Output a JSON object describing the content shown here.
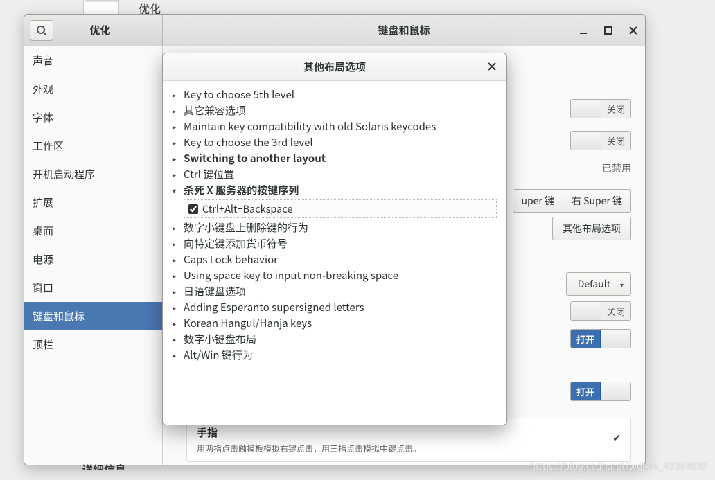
{
  "behind": {
    "title": "优化"
  },
  "window": {
    "title_left": "优化",
    "title_center": "键盘和鼠标",
    "controls": {
      "min": "—",
      "max": "□",
      "close": "×"
    }
  },
  "sidebar": {
    "items": [
      {
        "label": "声音"
      },
      {
        "label": "外观"
      },
      {
        "label": "字体"
      },
      {
        "label": "工作区"
      },
      {
        "label": "开机启动程序"
      },
      {
        "label": "扩展"
      },
      {
        "label": "桌面"
      },
      {
        "label": "电源"
      },
      {
        "label": "窗口"
      },
      {
        "label": "键盘和鼠标",
        "selected": true
      },
      {
        "label": "顶栏"
      }
    ]
  },
  "content": {
    "switch_off_label": "关闭",
    "switch_on_label": "打开",
    "disabled_text": "已禁用",
    "seg_left": "uper 键",
    "seg_right": "右  Super 键",
    "other_layout_btn": "其他布局选项",
    "combo_default": "Default",
    "fingers": {
      "title": "手指",
      "desc": "用两指点击触摸板模拟右键点击，用三指点击模拟中键点击。"
    }
  },
  "dialog": {
    "title": "其他布局选项",
    "items": [
      {
        "label": "Key to choose 5th level"
      },
      {
        "label": "其它兼容选项"
      },
      {
        "label": "Maintain key compatibility with old Solaris keycodes"
      },
      {
        "label": "Key to choose the 3rd level"
      },
      {
        "label": "Switching to another layout",
        "bold": true
      },
      {
        "label": "Ctrl 键位置"
      },
      {
        "label": "杀死  X 服务器的按键序列",
        "bold": true,
        "expanded": true,
        "child": "Ctrl+Alt+Backspace",
        "checked": true
      },
      {
        "label": "数字小键盘上删除键的行为"
      },
      {
        "label": "向特定键添加货币符号"
      },
      {
        "label": "Caps Lock behavior"
      },
      {
        "label": "Using space key to input non-breaking space"
      },
      {
        "label": "日语键盘选项"
      },
      {
        "label": "Adding Esperanto supersigned letters"
      },
      {
        "label": "Korean Hangul/Hanja keys"
      },
      {
        "label": "数字小键盘布局"
      },
      {
        "label": "Alt/Win 键行为"
      }
    ]
  },
  "truncated_text": "详细信息",
  "watermark": "https://blog.csdn.net/weixin_42384930"
}
